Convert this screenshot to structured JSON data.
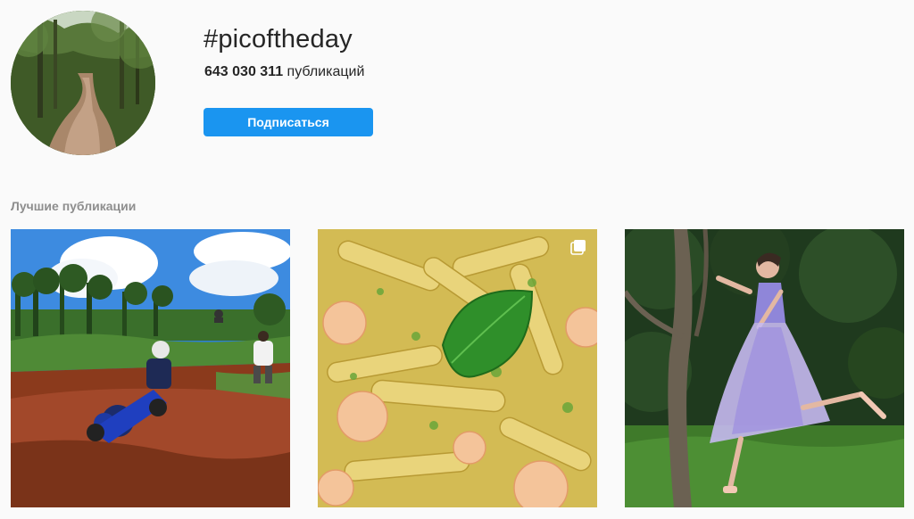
{
  "header": {
    "avatar_icon": "forest-dirt-road-photo",
    "hashtag": "#picoftheday",
    "post_count_value": "643 030 311",
    "post_count_label": "публикаций",
    "follow_button_label": "Подписаться",
    "accent_color": "#1a95f0"
  },
  "top_posts": {
    "section_title": "Лучшие публикации",
    "posts": [
      {
        "image": "motocross-rider-photo",
        "multi_image_icon": "carousel-icon"
      },
      {
        "image": "pasta-with-shrimp-and-basil-photo",
        "multi_image_icon": "carousel-icon"
      },
      {
        "image": "ballerina-by-tree-photo"
      }
    ]
  }
}
